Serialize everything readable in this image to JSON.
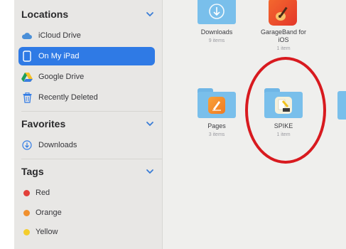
{
  "sidebar": {
    "locations_header": "Locations",
    "locations": [
      {
        "label": "iCloud Drive",
        "icon": "cloud-icon"
      },
      {
        "label": "On My iPad",
        "icon": "ipad-icon",
        "selected": true
      },
      {
        "label": "Google Drive",
        "icon": "google-drive-icon"
      },
      {
        "label": "Recently Deleted",
        "icon": "trash-icon"
      }
    ],
    "favorites_header": "Favorites",
    "favorites": [
      {
        "label": "Downloads",
        "icon": "download-icon"
      }
    ],
    "tags_header": "Tags",
    "tags": [
      {
        "label": "Red",
        "color": "#e2403a"
      },
      {
        "label": "Orange",
        "color": "#f0902e"
      },
      {
        "label": "Yellow",
        "color": "#f4cd2c"
      }
    ]
  },
  "files": [
    {
      "name": "Downloads",
      "meta": "9 items",
      "icon": "downloads-folder-icon"
    },
    {
      "name": "GarageBand for iOS",
      "meta": "1 item",
      "icon": "garageband-icon"
    },
    {
      "name": "Pages",
      "meta": "3 items",
      "icon": "pages-folder-icon"
    },
    {
      "name": "SPIKE",
      "meta": "1 item",
      "icon": "spike-folder-icon"
    }
  ],
  "colors": {
    "accent": "#2f7ae5",
    "highlight": "#d81a1f",
    "folder": "#79bfeb"
  }
}
